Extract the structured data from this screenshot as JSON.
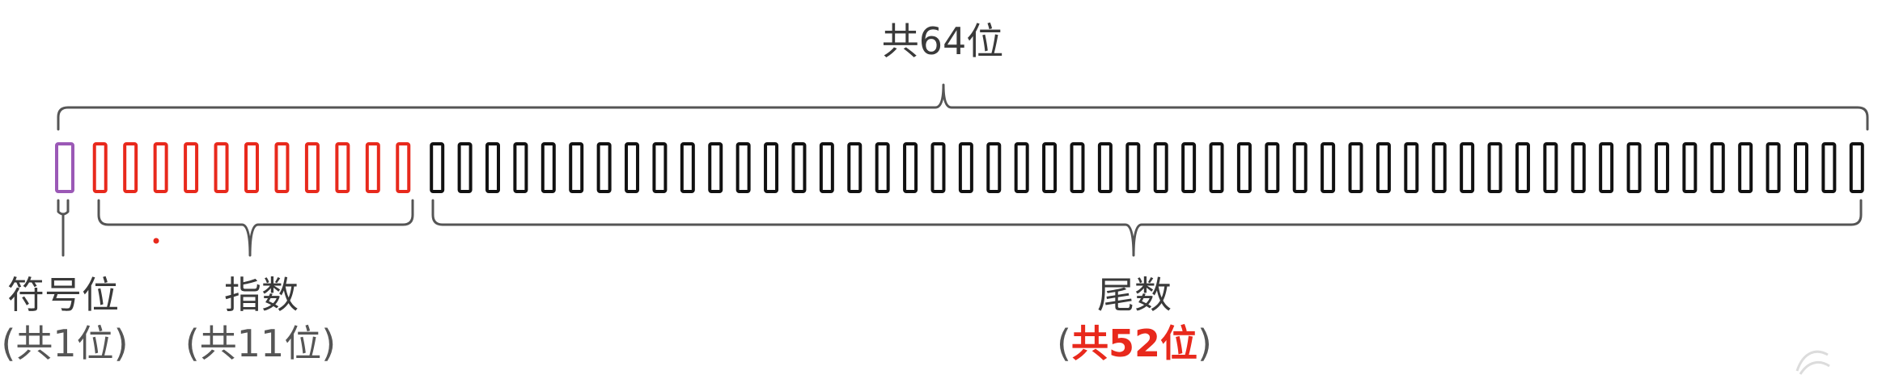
{
  "diagram": {
    "total_label": "共64位",
    "fields": [
      {
        "key": "sign",
        "name": "符号位",
        "count_label": "(共1位)",
        "bits": 1,
        "color": "#9b59b6",
        "highlight": false
      },
      {
        "key": "exponent",
        "name": "指数",
        "count_label": "(共11位)",
        "bits": 11,
        "color": "#e8291c",
        "highlight": false
      },
      {
        "key": "mantissa",
        "name": "尾数",
        "count_label_open": "(",
        "count_label_value": "共52位",
        "count_label_close": ")",
        "bits": 52,
        "color": "#111111",
        "highlight": true
      }
    ],
    "colors": {
      "brace": "#555555",
      "text": "#3a3a3a",
      "highlight_text": "#e8291c",
      "dot": "#e8291c"
    }
  }
}
